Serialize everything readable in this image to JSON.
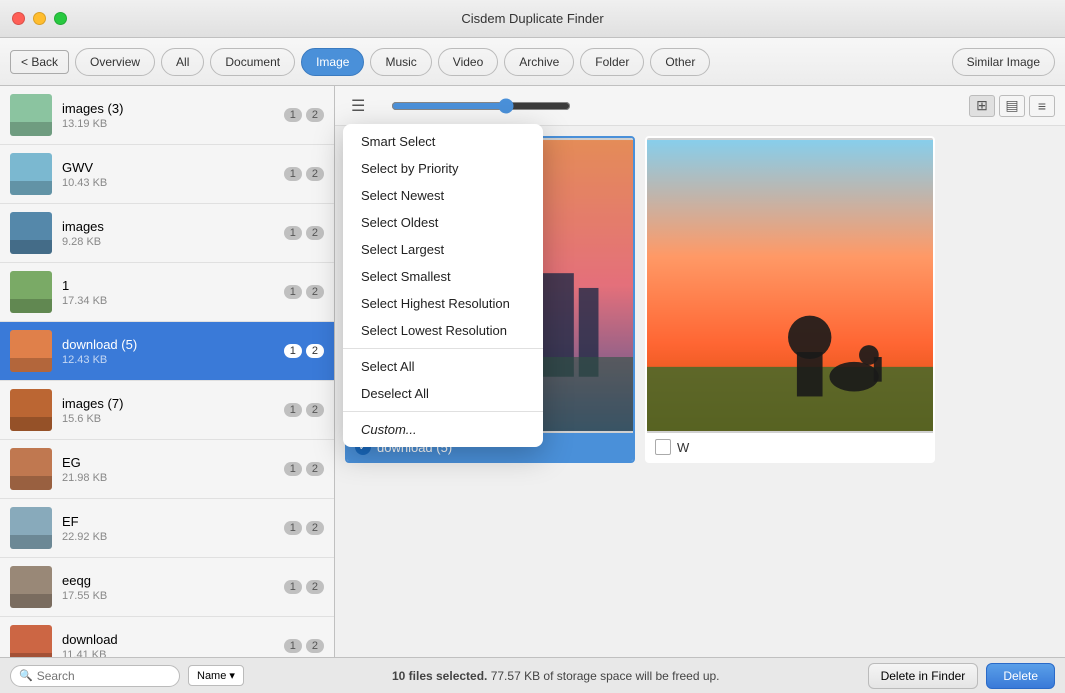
{
  "app": {
    "title": "Cisdem Duplicate Finder"
  },
  "nav": {
    "back_label": "< Back",
    "tabs": [
      {
        "id": "overview",
        "label": "Overview",
        "active": false
      },
      {
        "id": "all",
        "label": "All",
        "active": false
      },
      {
        "id": "document",
        "label": "Document",
        "active": false
      },
      {
        "id": "image",
        "label": "Image",
        "active": true
      },
      {
        "id": "music",
        "label": "Music",
        "active": false
      },
      {
        "id": "video",
        "label": "Video",
        "active": false
      },
      {
        "id": "archive",
        "label": "Archive",
        "active": false
      },
      {
        "id": "folder",
        "label": "Folder",
        "active": false
      },
      {
        "id": "other",
        "label": "Other",
        "active": false
      }
    ],
    "similar_image": "Similar Image"
  },
  "list_items": [
    {
      "id": 0,
      "name": "images (3)",
      "size": "13.19 KB",
      "count1": "1",
      "count2": "2",
      "selected": false,
      "color": "#8bc4a0"
    },
    {
      "id": 1,
      "name": "GWV",
      "size": "10.43 KB",
      "count1": "1",
      "count2": "2",
      "selected": false,
      "color": "#7bb8d0"
    },
    {
      "id": 2,
      "name": "images",
      "size": "9.28 KB",
      "count1": "1",
      "count2": "2",
      "selected": false,
      "color": "#5588aa"
    },
    {
      "id": 3,
      "name": "1",
      "size": "17.34 KB",
      "count1": "1",
      "count2": "2",
      "selected": false,
      "color": "#7aaa66"
    },
    {
      "id": 4,
      "name": "download (5)",
      "size": "12.43 KB",
      "count1": "1",
      "count2": "2",
      "selected": true,
      "color": "#e0804a"
    },
    {
      "id": 5,
      "name": "images (7)",
      "size": "15.6 KB",
      "count1": "1",
      "count2": "2",
      "selected": false,
      "color": "#bb6633"
    },
    {
      "id": 6,
      "name": "EG",
      "size": "21.98 KB",
      "count1": "1",
      "count2": "2",
      "selected": false,
      "color": "#c07850"
    },
    {
      "id": 7,
      "name": "EF",
      "size": "22.92 KB",
      "count1": "1",
      "count2": "2",
      "selected": false,
      "color": "#88aabb"
    },
    {
      "id": 8,
      "name": "eeqg",
      "size": "17.55 KB",
      "count1": "1",
      "count2": "2",
      "selected": false,
      "color": "#998877"
    },
    {
      "id": 9,
      "name": "download",
      "size": "11.41 KB",
      "count1": "1",
      "count2": "2",
      "selected": false,
      "color": "#cc6644"
    }
  ],
  "dropdown": {
    "items": [
      {
        "id": "smart-select",
        "label": "Smart Select",
        "separator_after": false
      },
      {
        "id": "select-by-priority",
        "label": "Select by Priority",
        "separator_after": false
      },
      {
        "id": "select-newest",
        "label": "Select Newest",
        "separator_after": false
      },
      {
        "id": "select-oldest",
        "label": "Select Oldest",
        "separator_after": false
      },
      {
        "id": "select-largest",
        "label": "Select Largest",
        "separator_after": false
      },
      {
        "id": "select-smallest",
        "label": "Select Smallest",
        "separator_after": false
      },
      {
        "id": "select-highest-resolution",
        "label": "Select Highest Resolution",
        "separator_after": false
      },
      {
        "id": "select-lowest-resolution",
        "label": "Select Lowest Resolution",
        "separator_after": true
      },
      {
        "id": "select-all",
        "label": "Select All",
        "separator_after": false
      },
      {
        "id": "deselect-all",
        "label": "Deselect All",
        "separator_after": true
      },
      {
        "id": "custom",
        "label": "Custom...",
        "separator_after": false
      }
    ]
  },
  "image_cards": [
    {
      "id": 0,
      "label": "download (5)",
      "checked": true,
      "bg_color": "#b0bec5"
    },
    {
      "id": 1,
      "label": "W",
      "checked": false,
      "bg_color": "#ccc"
    }
  ],
  "view_icons": {
    "grid": "⊞",
    "filmstrip": "▤",
    "list": "≡"
  },
  "search": {
    "placeholder": "Search",
    "value": ""
  },
  "sort": {
    "label": "Name ▾"
  },
  "status": {
    "text": "10 files selected.",
    "size_text": "77.57 KB",
    "suffix": "of storage space will be freed up."
  },
  "buttons": {
    "delete_finder": "Delete in Finder",
    "delete": "Delete"
  },
  "colors": {
    "accent": "#4a90d9",
    "selected_bg": "#3a7ad8"
  }
}
